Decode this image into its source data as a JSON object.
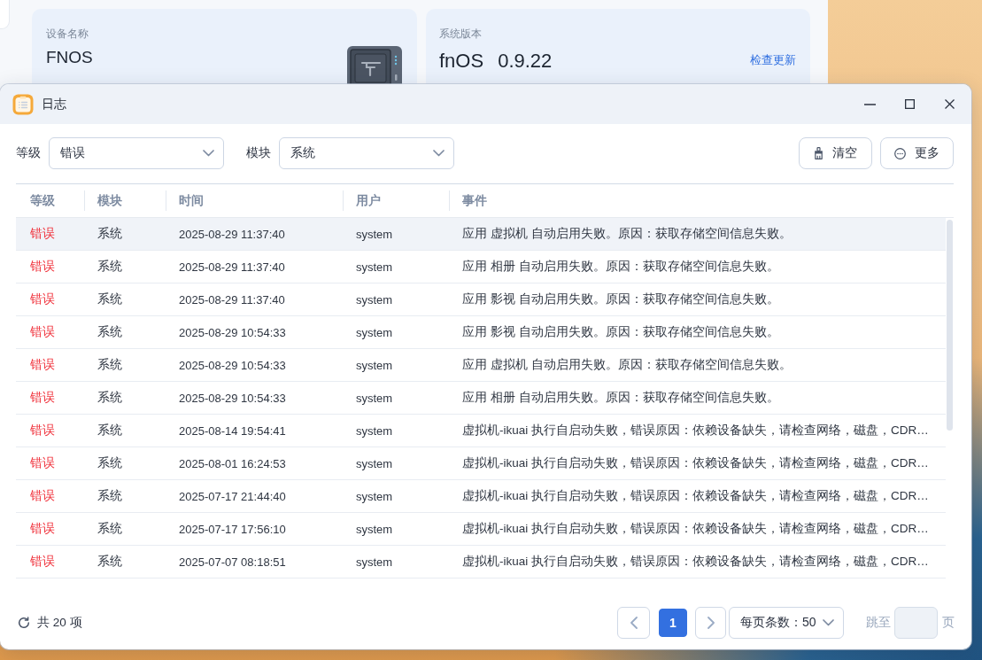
{
  "background_window": {
    "device_card": {
      "label": "设备名称",
      "value": "FNOS"
    },
    "version_card": {
      "label": "系统版本",
      "os_name": "fnOS",
      "version": "0.9.22",
      "link": "检查更新"
    }
  },
  "window": {
    "title": "日志"
  },
  "filters": [
    {
      "label": "等级",
      "value": "错误"
    },
    {
      "label": "模块",
      "value": "系统"
    }
  ],
  "actions": [
    {
      "kind": "clear",
      "label": "清空"
    },
    {
      "kind": "more",
      "label": "更多"
    }
  ],
  "table": {
    "columns": [
      "等级",
      "模块",
      "时间",
      "用户",
      "事件"
    ],
    "rows": [
      {
        "level": "错误",
        "module": "系统",
        "time": "2025-08-29 11:37:40",
        "user": "system",
        "event": "应用 虚拟机 自动启用失败。原因：获取存储空间信息失败。",
        "highlighted": true
      },
      {
        "level": "错误",
        "module": "系统",
        "time": "2025-08-29 11:37:40",
        "user": "system",
        "event": "应用 相册 自动启用失败。原因：获取存储空间信息失败。",
        "highlighted": false
      },
      {
        "level": "错误",
        "module": "系统",
        "time": "2025-08-29 11:37:40",
        "user": "system",
        "event": "应用 影视 自动启用失败。原因：获取存储空间信息失败。",
        "highlighted": false
      },
      {
        "level": "错误",
        "module": "系统",
        "time": "2025-08-29 10:54:33",
        "user": "system",
        "event": "应用 影视 自动启用失败。原因：获取存储空间信息失败。",
        "highlighted": false
      },
      {
        "level": "错误",
        "module": "系统",
        "time": "2025-08-29 10:54:33",
        "user": "system",
        "event": "应用 虚拟机 自动启用失败。原因：获取存储空间信息失败。",
        "highlighted": false
      },
      {
        "level": "错误",
        "module": "系统",
        "time": "2025-08-29 10:54:33",
        "user": "system",
        "event": "应用 相册 自动启用失败。原因：获取存储空间信息失败。",
        "highlighted": false
      },
      {
        "level": "错误",
        "module": "系统",
        "time": "2025-08-14 19:54:41",
        "user": "system",
        "event": "虚拟机-ikuai 执行自启动失败，错误原因：依赖设备缺失，请检查网络，磁盘，CDR…",
        "highlighted": false
      },
      {
        "level": "错误",
        "module": "系统",
        "time": "2025-08-01 16:24:53",
        "user": "system",
        "event": "虚拟机-ikuai 执行自启动失败，错误原因：依赖设备缺失，请检查网络，磁盘，CDR…",
        "highlighted": false
      },
      {
        "level": "错误",
        "module": "系统",
        "time": "2025-07-17 21:44:40",
        "user": "system",
        "event": "虚拟机-ikuai 执行自启动失败，错误原因：依赖设备缺失，请检查网络，磁盘，CDR…",
        "highlighted": false
      },
      {
        "level": "错误",
        "module": "系统",
        "time": "2025-07-17 17:56:10",
        "user": "system",
        "event": "虚拟机-ikuai 执行自启动失败，错误原因：依赖设备缺失，请检查网络，磁盘，CDR…",
        "highlighted": false
      },
      {
        "level": "错误",
        "module": "系统",
        "time": "2025-07-07 08:18:51",
        "user": "system",
        "event": "虚拟机-ikuai 执行自启动失败，错误原因：依赖设备缺失，请检查网络，磁盘，CDR…",
        "highlighted": false
      }
    ]
  },
  "footer": {
    "total": "共 20 项",
    "pages": [
      {
        "label": "1",
        "selected": true
      }
    ],
    "page_size": "每页条数：50",
    "jump_label": "跳至",
    "jump_suffix": "页"
  }
}
